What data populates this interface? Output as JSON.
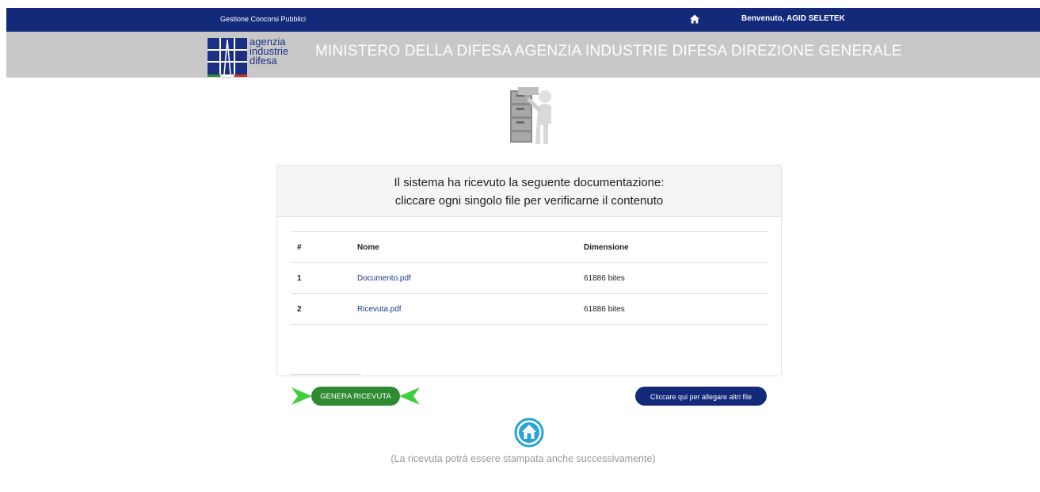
{
  "topbar": {
    "brand": "Gestione Concorsi Pubblici",
    "home_icon": "home-icon",
    "welcome": "Benvenuto, AGID SELETEK"
  },
  "header": {
    "logo_lines": [
      "agenzia",
      "industrie",
      "difesa"
    ],
    "title": "MINISTERO DELLA DIFESA AGENZIA INDUSTRIE DIFESA DIREZIONE GENERALE"
  },
  "panel": {
    "line1": "Il sistema ha ricevuto la seguente documentazione:",
    "line2": "cliccare ogni singolo file per verificarne il contenuto",
    "columns": [
      "#",
      "Nome",
      "Dimensione"
    ],
    "rows": [
      {
        "num": "1",
        "name": "Documento.pdf",
        "size": "61886 bites"
      },
      {
        "num": "2",
        "name": "Ricevuta.pdf",
        "size": "61886 bites"
      }
    ]
  },
  "actions": {
    "genera": "GENERA RICEVUTA",
    "allegare": "Cliccare qui per allegare altri file"
  },
  "footer": {
    "note": "(La ricevuta potrà essere stampata anche successivamente)"
  },
  "colors": {
    "navy": "#132a7a",
    "header_gray": "#c8c8c8",
    "green": "#2e8b32",
    "home_blue": "#29a3d6"
  }
}
